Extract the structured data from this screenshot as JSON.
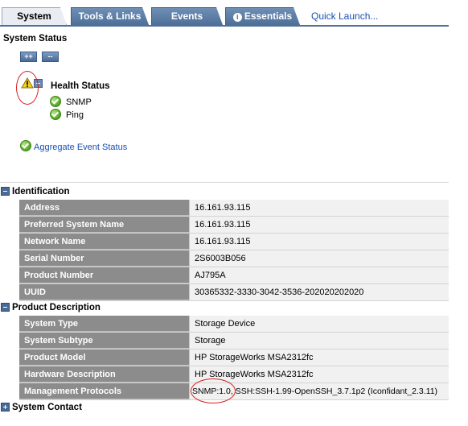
{
  "tabs": [
    {
      "label": "System",
      "active": true
    },
    {
      "label": "Tools & Links",
      "active": false
    },
    {
      "label": "Events",
      "active": false
    },
    {
      "label": "Essentials",
      "active": false,
      "icon": "info-icon"
    }
  ],
  "quick_launch": "Quick Launch...",
  "system_status": {
    "title": "System Status",
    "expand_all": "++",
    "collapse_all": "--",
    "health_status": "Health Status",
    "health_items": [
      "SNMP",
      "Ping"
    ],
    "aggregate_event_status": "Aggregate Event Status"
  },
  "identification": {
    "title": "Identification",
    "rows": [
      {
        "key": "Address",
        "value": "16.161.93.115"
      },
      {
        "key": "Preferred System Name",
        "value": "16.161.93.115"
      },
      {
        "key": "Network Name",
        "value": "16.161.93.115"
      },
      {
        "key": "Serial Number",
        "value": "2S6003B056"
      },
      {
        "key": "Product Number",
        "value": "AJ795A"
      },
      {
        "key": "UUID",
        "value": "30365332-3330-3042-3536-202020202020"
      }
    ]
  },
  "product_description": {
    "title": "Product Description",
    "rows": [
      {
        "key": "System Type",
        "value": "Storage Device"
      },
      {
        "key": "System Subtype",
        "value": "Storage"
      },
      {
        "key": "Product Model",
        "value": "HP StorageWorks MSA2312fc"
      },
      {
        "key": "Hardware Description",
        "value": "HP StorageWorks MSA2312fc"
      },
      {
        "key": "Management Protocols",
        "value": "SNMP:1.0, SSH:SSH-1.99-OpenSSH_3.7.1p2 (Iconfidant_2.3.11)"
      }
    ]
  },
  "system_contact": {
    "title": "System Contact"
  },
  "colors": {
    "tab": "#4d6f98",
    "link": "#1a4fb3",
    "annotation": "#d81e1e"
  }
}
